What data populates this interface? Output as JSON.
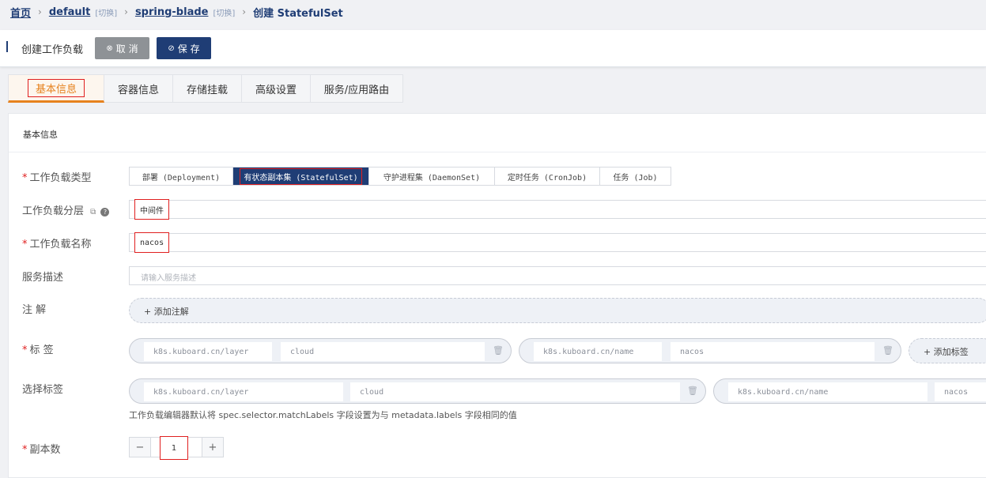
{
  "breadcrumb": {
    "home": "首页",
    "namespace": "default",
    "namespace_switch": "[切换]",
    "cluster": "spring-blade",
    "cluster_switch": "[切换]",
    "current": "创建 StatefulSet"
  },
  "header": {
    "title": "创建工作负载",
    "cancel_label": "取 消",
    "save_label": "保 存"
  },
  "tabs": [
    {
      "label": "基本信息",
      "active": true
    },
    {
      "label": "容器信息",
      "active": false
    },
    {
      "label": "存储挂载",
      "active": false
    },
    {
      "label": "高级设置",
      "active": false
    },
    {
      "label": "服务/应用路由",
      "active": false
    }
  ],
  "section_title": "基本信息",
  "form": {
    "workload_type": {
      "label": "工作负载类型",
      "required": "*",
      "options": [
        "部署 (Deployment)",
        "有状态副本集 (StatefulSet)",
        "守护进程集 (DaemonSet)",
        "定时任务 (CronJob)",
        "任务 (Job)"
      ],
      "selected": "有状态副本集 (StatefulSet)"
    },
    "layer": {
      "label": "工作负载分层",
      "value": "中间件"
    },
    "name": {
      "label": "工作负载名称",
      "required": "*",
      "value": "nacos"
    },
    "description": {
      "label": "服务描述",
      "placeholder": "请输入服务描述"
    },
    "annotations": {
      "label": "注 解",
      "add_label": "+ 添加注解"
    },
    "labels": {
      "label": "标 签",
      "required": "*",
      "items": [
        {
          "key": "k8s.kuboard.cn/layer",
          "value": "cloud"
        },
        {
          "key": "k8s.kuboard.cn/name",
          "value": "nacos"
        }
      ],
      "add_label": "+ 添加标签"
    },
    "selector": {
      "label": "选择标签",
      "items": [
        {
          "key": "k8s.kuboard.cn/layer",
          "value": "cloud"
        },
        {
          "key": "k8s.kuboard.cn/name",
          "value": "nacos"
        }
      ],
      "hint": "工作负载编辑器默认将 spec.selector.matchLabels 字段设置为与 metadata.labels 字段相同的值"
    },
    "replicas": {
      "label": "副本数",
      "required": "*",
      "value": "1",
      "minus": "−",
      "plus": "+"
    }
  },
  "colors": {
    "primary": "#1f3d75",
    "accent": "#e6821e",
    "highlight_border": "#e02020",
    "cancel": "#8e9296"
  },
  "icons": {
    "cancel": "circle-x-icon",
    "save": "circle-check-icon",
    "external_link": "external-link-icon",
    "help": "question-circle-icon",
    "trash": "trash-icon"
  }
}
